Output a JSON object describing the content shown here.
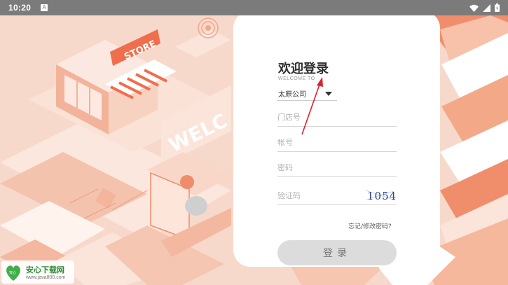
{
  "status_bar": {
    "time": "10:20",
    "notification_icon": "A"
  },
  "colors": {
    "accent": "#ef6e4c",
    "background": "#f6d3c4",
    "button": "#dcdcdc"
  },
  "illustration": {
    "store_sign": "STORE",
    "welcome_text": "WELC"
  },
  "login": {
    "title": "欢迎登录",
    "subtitle": "WELCOME TO",
    "city": "太原公司",
    "store_placeholder": "门店号",
    "account_placeholder": "帐号",
    "password_placeholder": "密码",
    "captcha_placeholder": "验证码",
    "captcha_code": "1054",
    "forgot_link": "忘记/修改密码?",
    "login_button": "登录"
  },
  "watermark": {
    "logo_text": "安心",
    "brand": "安心下载网",
    "url": "www.java800.com"
  }
}
